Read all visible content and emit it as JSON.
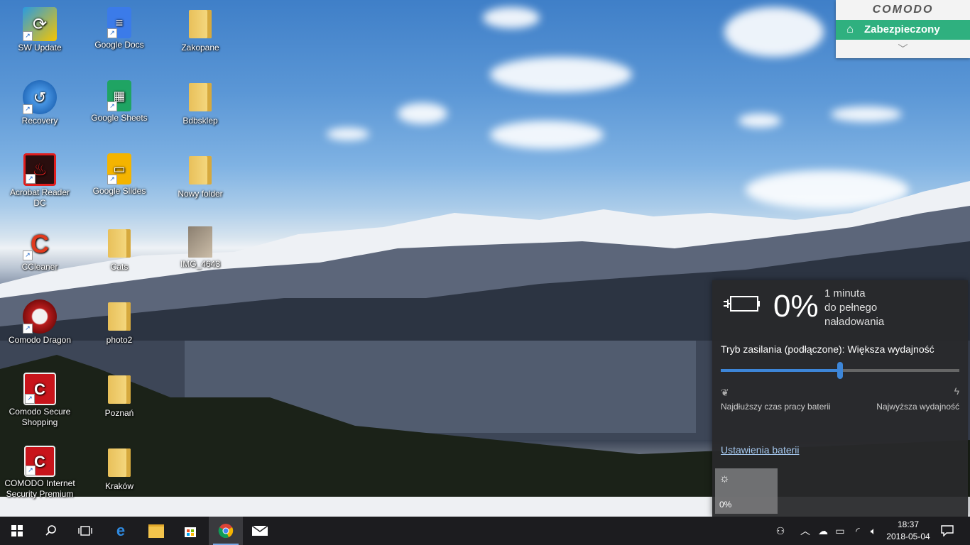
{
  "desktop": {
    "icons": [
      {
        "label": "SW Update",
        "icon": "sw-update-icon"
      },
      {
        "label": "Recovery",
        "icon": "recovery-icon"
      },
      {
        "label": "Acrobat Reader DC",
        "icon": "acrobat-icon"
      },
      {
        "label": "CCleaner",
        "icon": "ccleaner-icon"
      },
      {
        "label": "Comodo Dragon",
        "icon": "comodo-dragon-icon"
      },
      {
        "label": "Comodo Secure Shopping",
        "icon": "comodo-shopping-icon"
      },
      {
        "label": "COMODO Internet Security Premium",
        "icon": "comodo-internet-security-icon"
      },
      {
        "label": "Google Docs",
        "icon": "google-docs-icon"
      },
      {
        "label": "Google Sheets",
        "icon": "google-sheets-icon"
      },
      {
        "label": "Google Slides",
        "icon": "google-slides-icon"
      },
      {
        "label": "Cats",
        "icon": "folder-icon"
      },
      {
        "label": "photo2",
        "icon": "folder-icon"
      },
      {
        "label": "Poznań",
        "icon": "folder-icon"
      },
      {
        "label": "Kraków",
        "icon": "folder-icon"
      },
      {
        "label": "Zakopane",
        "icon": "folder-icon"
      },
      {
        "label": "Bdbsklep",
        "icon": "folder-icon"
      },
      {
        "label": "Nowy folder",
        "icon": "folder-icon"
      },
      {
        "label": "IMG_4643",
        "icon": "image-file-icon"
      }
    ]
  },
  "comodo_widget": {
    "brand": "COMODO",
    "status": "Zabezpieczony",
    "status_color": "#2fb07f"
  },
  "battery_flyout": {
    "percent": "0%",
    "remaining_line1": "1 minuta",
    "remaining_line2": "do pełnego",
    "remaining_line3": "naładowania",
    "power_mode": "Tryb zasilania (podłączone): Większa wydajność",
    "slider_value": 0.5,
    "left_label": "Najdłuższy czas pracy baterii",
    "right_label": "Najwyższa wydajność",
    "settings_link": "Ustawienia baterii",
    "brightness_value": "0%",
    "accent": "#3d86d8"
  },
  "taskbar": {
    "time": "18:37",
    "date": "2018-05-04",
    "pinned": [
      "start-icon",
      "search-icon",
      "task-view-icon",
      "edge-icon",
      "file-explorer-icon",
      "store-icon",
      "chrome-icon",
      "mail-icon"
    ],
    "tray": [
      "people-icon",
      "chevron-up-icon",
      "onedrive-icon",
      "battery-charging-icon",
      "wifi-icon",
      "volume-icon",
      "notifications-icon"
    ]
  }
}
